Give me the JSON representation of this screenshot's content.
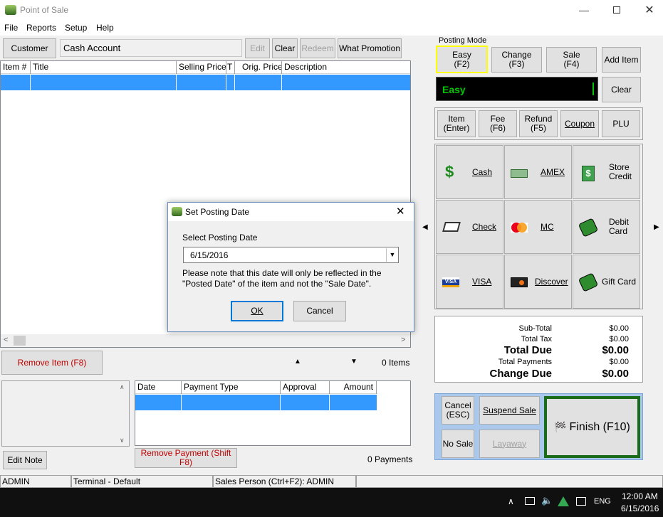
{
  "window": {
    "title": "Point of Sale"
  },
  "menu": {
    "file": "File",
    "reports": "Reports",
    "setup": "Setup",
    "help": "Help"
  },
  "toolbar": {
    "customer": "Customer",
    "customer_value": "Cash Account",
    "edit": "Edit",
    "clear": "Clear",
    "redeem": "Redeem",
    "what_promotion": "What Promotion"
  },
  "items_table": {
    "columns": [
      "Item #",
      "Title",
      "Selling Price",
      "T",
      "Orig. Price",
      "Description"
    ]
  },
  "posting_mode": {
    "label": "Posting Mode",
    "easy": "Easy\n(F2)",
    "change": "Change\n(F3)",
    "sale": "Sale\n(F4)",
    "add_item": "Add Item",
    "display": "Easy",
    "clear": "Clear"
  },
  "entry_buttons": {
    "item": "Item\n(Enter)",
    "fee": "Fee\n(F6)",
    "refund": "Refund\n(F5)",
    "coupon": "Coupon",
    "plu": "PLU"
  },
  "payment_buttons": {
    "cash": "Cash",
    "amex": "AMEX",
    "store_credit": "Store\nCredit",
    "check": "Check",
    "mc": "MC",
    "debit_card": "Debit\nCard",
    "visa": "VISA",
    "discover": "Discover",
    "gift_card": "Gift Card"
  },
  "totals": {
    "subtotal_label": "Sub-Total",
    "subtotal": "$0.00",
    "tax_label": "Total Tax",
    "tax": "$0.00",
    "due_label": "Total Due",
    "due": "$0.00",
    "payments_label": "Total Payments",
    "payments": "$0.00",
    "change_label": "Change Due",
    "change": "$0.00"
  },
  "item_controls": {
    "remove_item": "Remove Item (F8)",
    "items_count": "0 Items"
  },
  "payments_table": {
    "columns": [
      "Date",
      "Payment Type",
      "Approval",
      "Amount"
    ],
    "remove_payment": "Remove Payment (Shift F8)",
    "payments_count": "0 Payments"
  },
  "notes": {
    "edit_note": "Edit Note"
  },
  "actions": {
    "cancel": "Cancel\n(ESC)",
    "suspend": "Suspend Sale",
    "no_sale": "No Sale",
    "layaway": "Layaway",
    "finish": "Finish (F10)"
  },
  "status_bar": {
    "user": "ADMIN",
    "terminal": "Terminal - Default",
    "sales_person": "Sales Person (Ctrl+F2): ADMIN"
  },
  "dialog": {
    "title": "Set Posting Date",
    "label": "Select Posting Date",
    "date_value": "6/15/2016",
    "note": "Please note that this date will only be reflected in the \"Posted Date\" of the item and not the \"Sale Date\".",
    "ok": "OK",
    "cancel": "Cancel"
  },
  "taskbar": {
    "language": "ENG",
    "time": "12:00 AM",
    "date": "6/15/2016"
  },
  "colors": {
    "selection": "#3399ff",
    "display_text": "#00c800",
    "highlight_border": "#ffff00",
    "finish_border": "#1a6b1a",
    "remove_text": "#c00000"
  }
}
